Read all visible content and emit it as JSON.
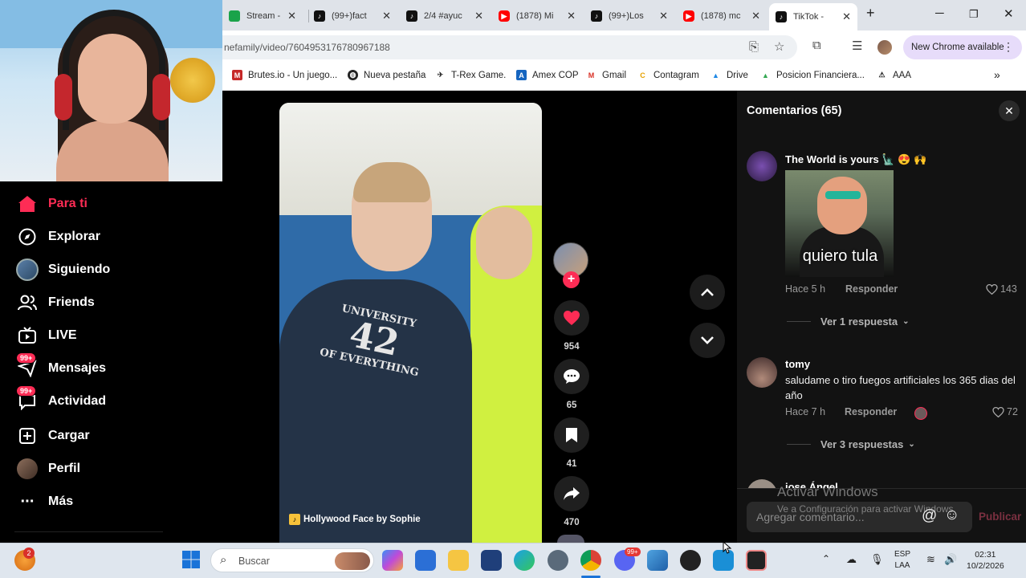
{
  "browser": {
    "tabs": [
      {
        "label": "Stream - ",
        "favicon": "tiktok"
      },
      {
        "label": "(99+)fact",
        "favicon": "tiktok"
      },
      {
        "label": "2/4 #ayuc",
        "favicon": "tiktok"
      },
      {
        "label": "(1878) Mi",
        "favicon": "youtube"
      },
      {
        "label": "(99+)Los",
        "favicon": "tiktok"
      },
      {
        "label": "(1878) mc",
        "favicon": "youtube"
      },
      {
        "label": "TikTok - ",
        "favicon": "tiktok"
      }
    ],
    "active_tab_index": 6,
    "url": "nefamily/video/7604953176780967188",
    "new_chrome_label": "New Chrome available",
    "bookmarks": [
      "Brutes.io - Un juego...",
      "Nueva pestaña",
      "T-Rex Game.",
      "Amex COP",
      "Gmail",
      "Contagram",
      "Drive",
      "Posicion Financiera...",
      "AAA"
    ]
  },
  "sidebar": {
    "items": [
      {
        "label": "Para ti",
        "icon": "home-icon",
        "active": true
      },
      {
        "label": "Explorar",
        "icon": "compass-icon"
      },
      {
        "label": "Siguiendo",
        "icon": "following-avatar-icon"
      },
      {
        "label": "Friends",
        "icon": "friends-icon"
      },
      {
        "label": "LIVE",
        "icon": "live-icon"
      },
      {
        "label": "Mensajes",
        "icon": "messages-icon",
        "badge": "99+"
      },
      {
        "label": "Actividad",
        "icon": "activity-icon",
        "badge": "99+"
      },
      {
        "label": "Cargar",
        "icon": "upload-icon"
      },
      {
        "label": "Perfil",
        "icon": "profile-avatar-icon"
      },
      {
        "label": "Más",
        "icon": "more-icon"
      }
    ]
  },
  "video": {
    "sound": "Hollywood Face by Sophie",
    "shirt_text": {
      "top": "UNIVERSITY",
      "number": "42",
      "bottom": "OF EVERYTHING"
    },
    "likes": "954",
    "comments": "65",
    "saves": "41",
    "shares": "470"
  },
  "comments": {
    "title": "Comentarios (65)",
    "items": [
      {
        "user": "The World is yours 🗽 😍 🙌",
        "sticker_caption": "quiero tula",
        "time": "Hace 5 h",
        "reply": "Responder",
        "likes": "143",
        "replies": "Ver 1 respuesta"
      },
      {
        "user": "tomy",
        "text": "saludame o tiro fuegos artificiales los 365 dias del año",
        "time": "Hace 7 h",
        "reply": "Responder",
        "likes": "72",
        "replies": "Ver 3 respuestas"
      },
      {
        "user": "jose Ángel"
      }
    ],
    "input_placeholder": "Agregar comentario...",
    "publish": "Publicar"
  },
  "watermark": {
    "line1": "Activar Windows",
    "line2": "Ve a Configuración para activar Windows."
  },
  "taskbar": {
    "search_placeholder": "Buscar",
    "notification_badge": "2",
    "discord_badge": "99+",
    "lang_1": "ESP",
    "lang_2": "LAA",
    "time": "02:31",
    "date": "10/2/2026"
  },
  "colors": {
    "accent": "#fe2c55",
    "panel": "#121212",
    "taskbar": "#dfe6ee"
  }
}
